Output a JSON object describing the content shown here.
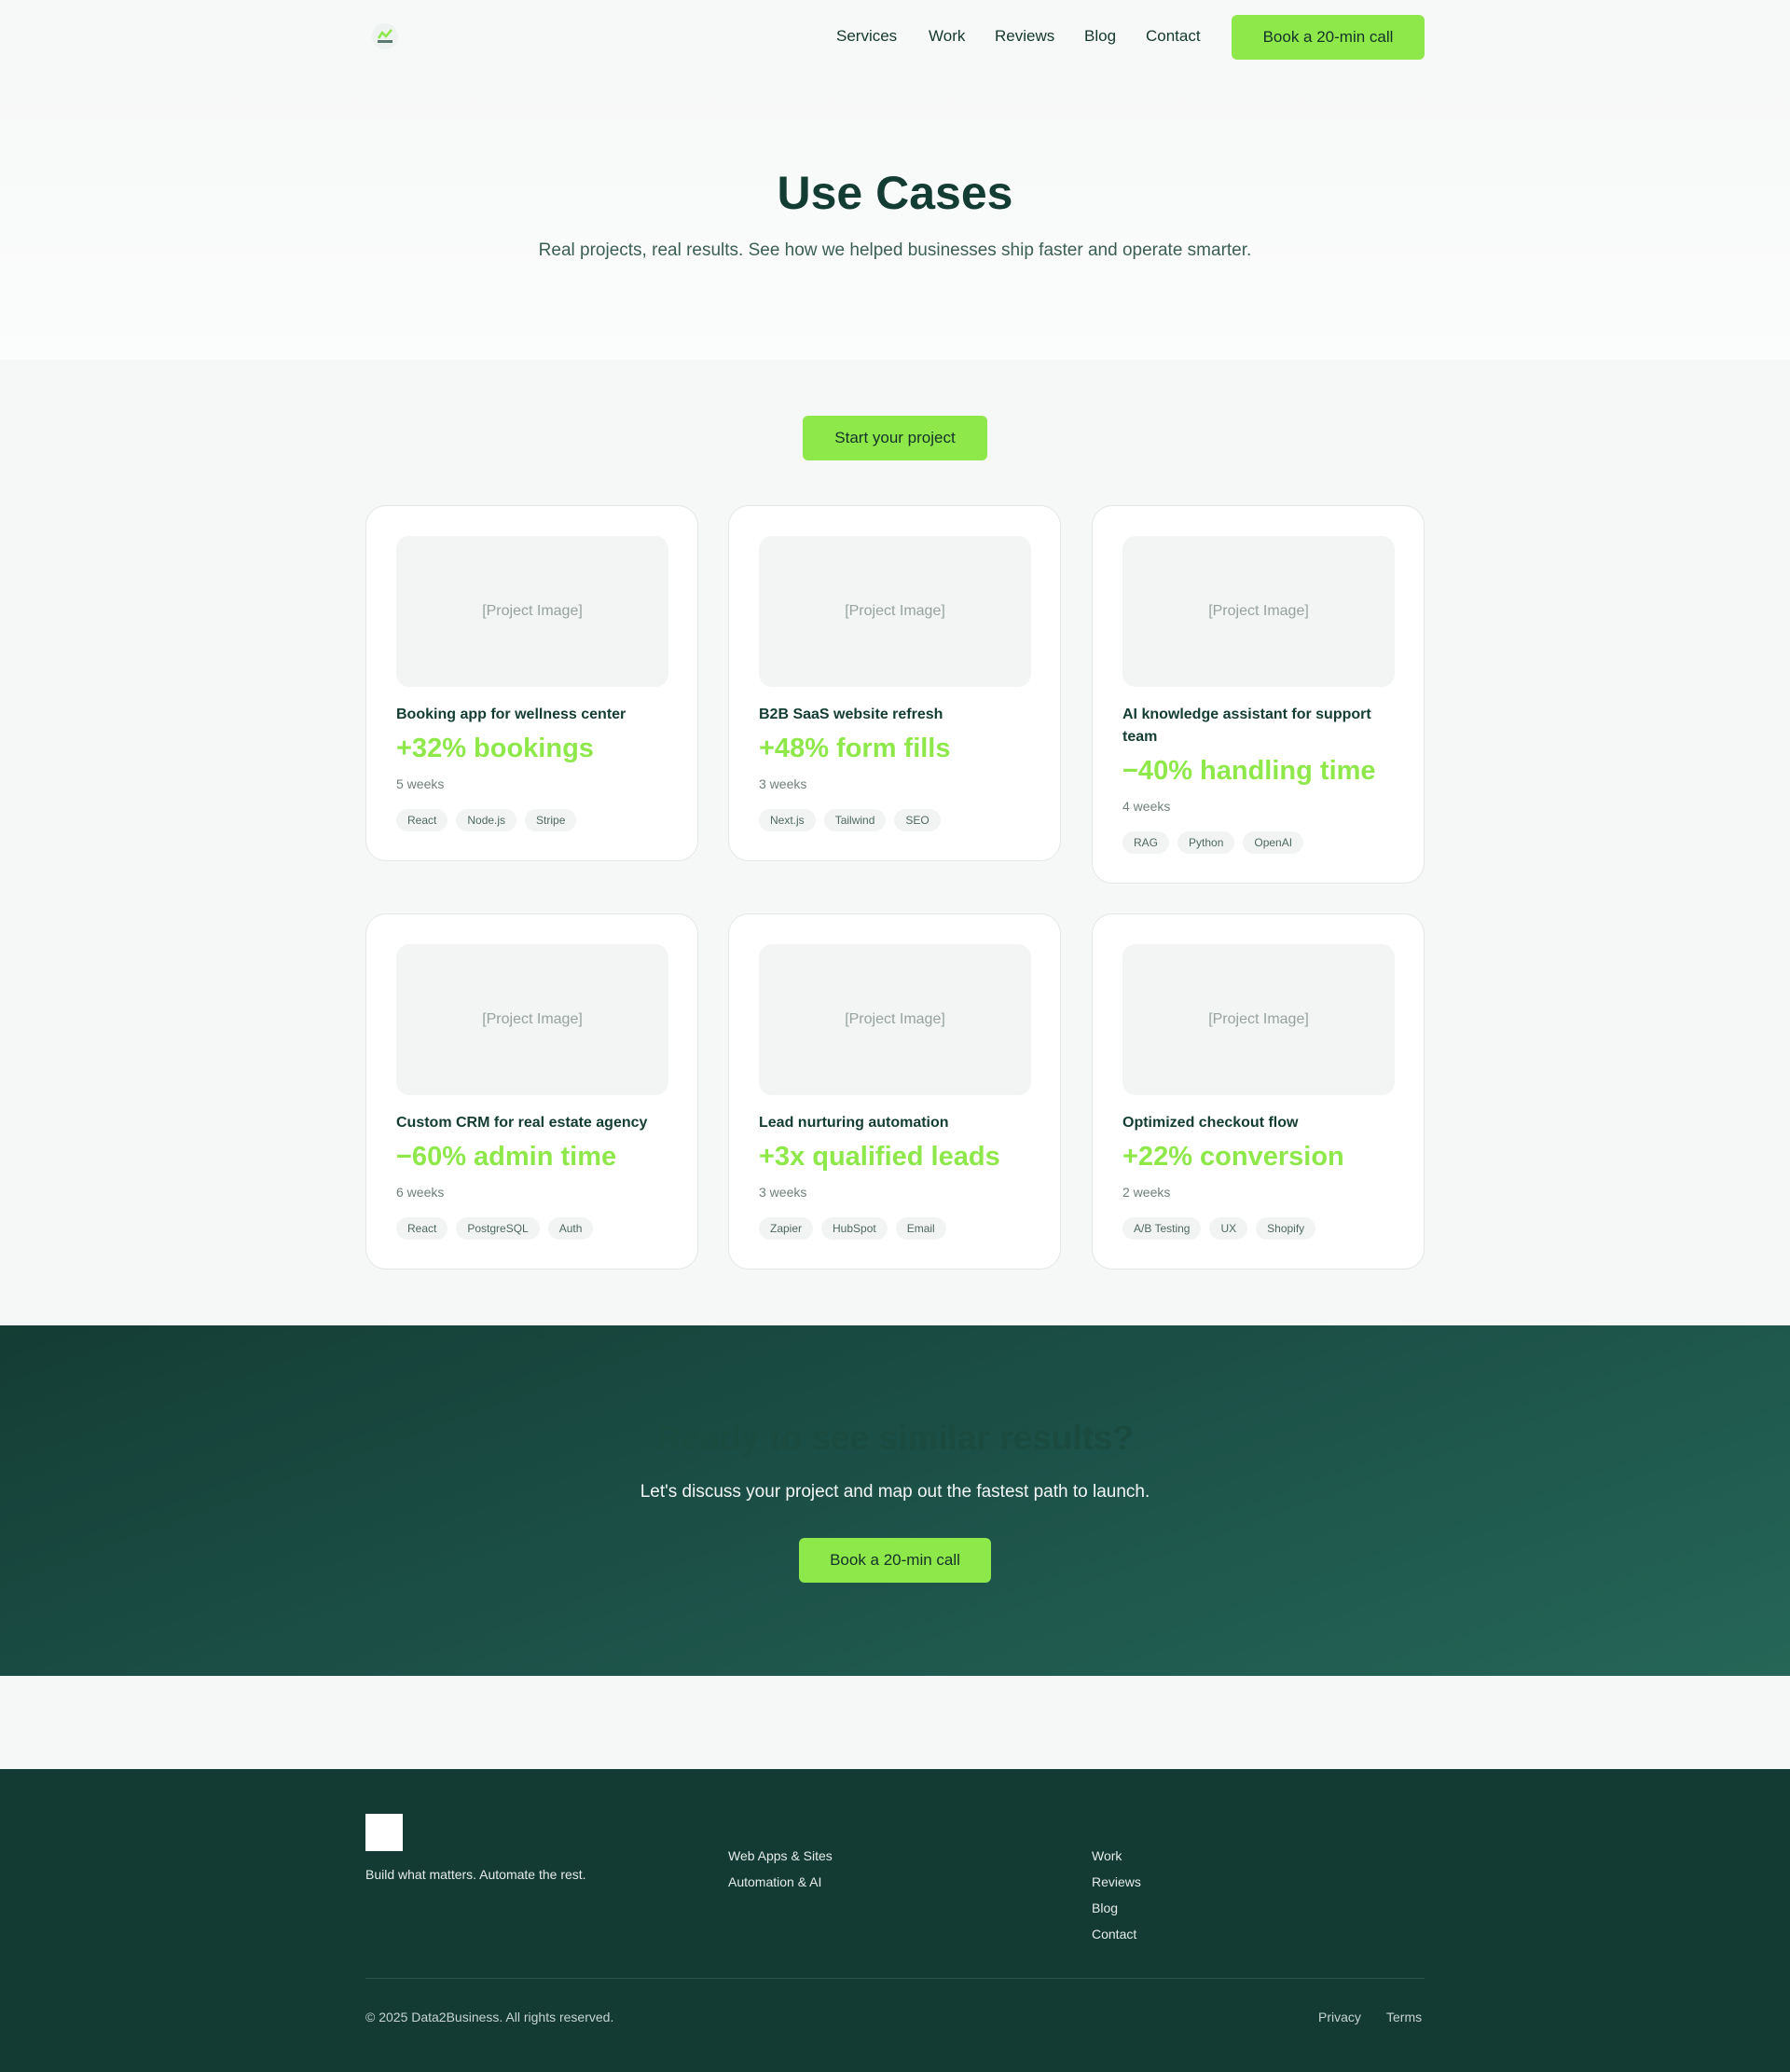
{
  "header": {
    "nav": [
      "Services",
      "Work",
      "Reviews",
      "Blog",
      "Contact"
    ],
    "cta_label": "Book a 20-min call"
  },
  "hero": {
    "title": "Use Cases",
    "subtitle": "Real projects, real results. See how we helped businesses ship faster and operate smarter."
  },
  "start_label": "Start your project",
  "cards": [
    {
      "image": "[Project Image]",
      "title": "Booking app for wellness center",
      "metric": "+32% bookings",
      "duration": "5 weeks",
      "tags": [
        "React",
        "Node.js",
        "Stripe"
      ]
    },
    {
      "image": "[Project Image]",
      "title": "B2B SaaS website refresh",
      "metric": "+48% form fills",
      "duration": "3 weeks",
      "tags": [
        "Next.js",
        "Tailwind",
        "SEO"
      ]
    },
    {
      "image": "[Project Image]",
      "title": "AI knowledge assistant for support team",
      "metric": "−40% handling time",
      "duration": "4 weeks",
      "tags": [
        "RAG",
        "Python",
        "OpenAI"
      ]
    },
    {
      "image": "[Project Image]",
      "title": "Custom CRM for real estate agency",
      "metric": "−60% admin time",
      "duration": "6 weeks",
      "tags": [
        "React",
        "PostgreSQL",
        "Auth"
      ]
    },
    {
      "image": "[Project Image]",
      "title": "Lead nurturing automation",
      "metric": "+3x qualified leads",
      "duration": "3 weeks",
      "tags": [
        "Zapier",
        "HubSpot",
        "Email"
      ]
    },
    {
      "image": "[Project Image]",
      "title": "Optimized checkout flow",
      "metric": "+22% conversion",
      "duration": "2 weeks",
      "tags": [
        "A/B Testing",
        "UX",
        "Shopify"
      ]
    }
  ],
  "cta": {
    "title": "Ready to see similar results?",
    "subtitle": "Let's discuss your project and map out the fastest path to launch.",
    "button": "Book a 20-min call"
  },
  "footer": {
    "tagline": "Build what matters. Automate the rest.",
    "services": [
      "Web Apps & Sites",
      "Automation & AI"
    ],
    "links": [
      "Work",
      "Reviews",
      "Blog",
      "Contact"
    ],
    "copyright": "© 2025 Data2Business. All rights reserved.",
    "privacy": "Privacy",
    "terms": "Terms"
  },
  "colors": {
    "accent": "#8ee84a",
    "dark": "#133a33"
  },
  "icons": {
    "logo": "data2business-logo"
  }
}
